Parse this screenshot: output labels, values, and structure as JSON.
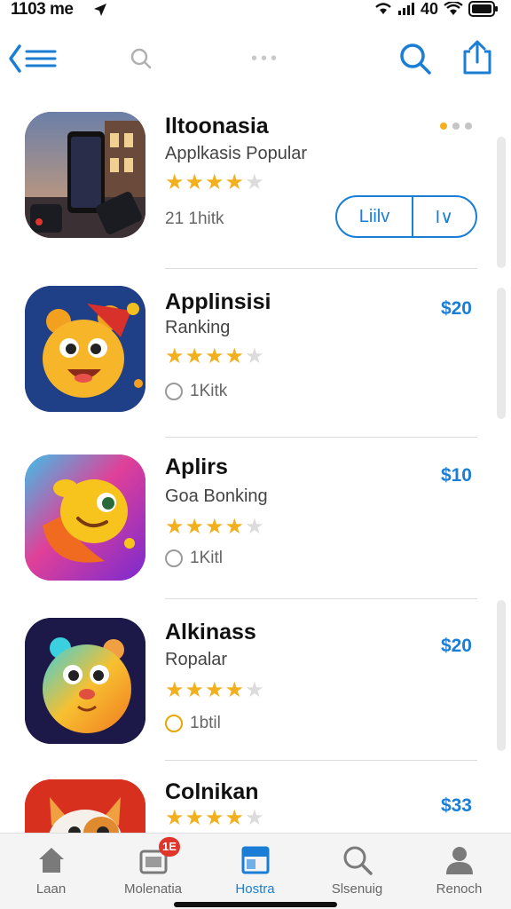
{
  "status": {
    "time": "1103 me",
    "signal_text": "40"
  },
  "nav": {
    "search_dots": "•••"
  },
  "apps": [
    {
      "name": "Iltoonasia",
      "subtitle": "Applkasis Popular",
      "rating": 4,
      "meta": "21 1hitk",
      "get_label": "Liilv",
      "dropdown": "I∨"
    },
    {
      "name": "Applinsisi",
      "subtitle": "Ranking",
      "rating": 4,
      "meta": "1Kitk",
      "price": "$20"
    },
    {
      "name": "Aplirs",
      "subtitle": "Goa Bonking",
      "rating": 4,
      "meta": "1Kitl",
      "price": "$10"
    },
    {
      "name": "Alkinass",
      "subtitle": "Ropalar",
      "rating": 4,
      "meta": "1btil",
      "price": "$20"
    },
    {
      "name": "Colnikan",
      "subtitle": "",
      "rating": 4,
      "meta": "",
      "price": "$33"
    }
  ],
  "tabs": [
    {
      "label": "Laan",
      "icon": "home-icon"
    },
    {
      "label": "Molenatia",
      "icon": "media-icon",
      "badge": "1E"
    },
    {
      "label": "Hostra",
      "icon": "apps-icon",
      "active": true
    },
    {
      "label": "Slsenuig",
      "icon": "search-icon"
    },
    {
      "label": "Renoch",
      "icon": "person-icon"
    }
  ],
  "colors": {
    "accent": "#1a7ed6",
    "star": "#f2b01e",
    "badge": "#e0352b"
  }
}
